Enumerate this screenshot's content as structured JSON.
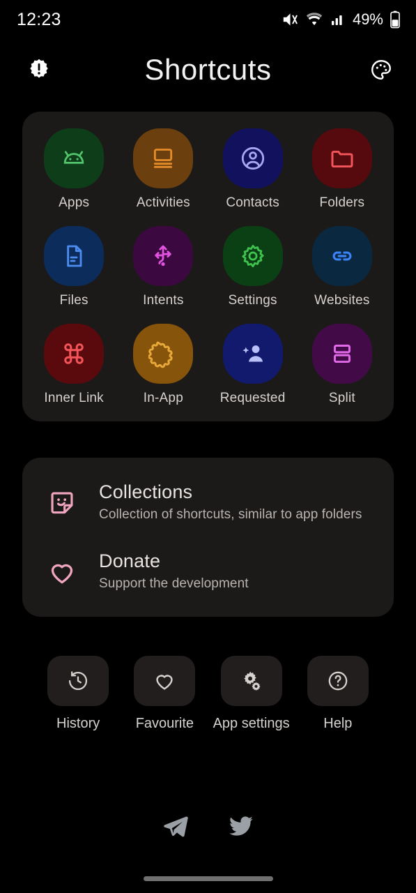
{
  "status_bar": {
    "time": "12:23",
    "battery_percent": "49%",
    "icons": [
      "mute-icon",
      "wifi-icon",
      "cellular-signal-icon",
      "battery-icon"
    ]
  },
  "app_bar": {
    "title": "Shortcuts",
    "left_icon": "new-releases-icon",
    "right_icon": "palette-icon"
  },
  "shortcut_grid": [
    {
      "label": "Apps",
      "icon": "android-icon",
      "bg": "#0d3d19",
      "fg": "#52c46b"
    },
    {
      "label": "Activities",
      "icon": "window-stack-icon",
      "bg": "#6b400e",
      "fg": "#e58b2a"
    },
    {
      "label": "Contacts",
      "icon": "account-circle-icon",
      "bg": "#12115e",
      "fg": "#a8a8f0"
    },
    {
      "label": "Folders",
      "icon": "folder-icon",
      "bg": "#560a0d",
      "fg": "#f4555a"
    },
    {
      "label": "Files",
      "icon": "document-icon",
      "bg": "#0c2c5c",
      "fg": "#4d8df0"
    },
    {
      "label": "Intents",
      "icon": "intent-arrows-icon",
      "bg": "#3c0840",
      "fg": "#e053de"
    },
    {
      "label": "Settings",
      "icon": "gear-icon",
      "bg": "#0b3f14",
      "fg": "#3fc34f"
    },
    {
      "label": "Websites",
      "icon": "link-icon",
      "bg": "#0a2940",
      "fg": "#3b82f6"
    },
    {
      "label": "Inner Link",
      "icon": "command-key-icon",
      "bg": "#5a0a0d",
      "fg": "#f4555a"
    },
    {
      "label": "In-App",
      "icon": "puzzle-piece-icon",
      "bg": "#86540b",
      "fg": "#e8a83a"
    },
    {
      "label": "Requested",
      "icon": "person-star-icon",
      "bg": "#121a6e",
      "fg": "#b8c2f8"
    },
    {
      "label": "Split",
      "icon": "split-screen-icon",
      "bg": "#420b48",
      "fg": "#e06ae8"
    }
  ],
  "list_items": [
    {
      "title": "Collections",
      "subtitle": "Collection of shortcuts, similar to app folders",
      "icon": "sticker-smile-icon",
      "color": "#f0a5c0"
    },
    {
      "title": "Donate",
      "subtitle": "Support the development",
      "icon": "heart-outline-icon",
      "color": "#f0a5c0"
    }
  ],
  "quick_actions": [
    {
      "label": "History",
      "icon": "history-clock-icon"
    },
    {
      "label": "Favourite",
      "icon": "heart-icon"
    },
    {
      "label": "App settings",
      "icon": "gears-settings-icon"
    },
    {
      "label": "Help",
      "icon": "help-circle-icon"
    }
  ],
  "footer_links": [
    {
      "name": "telegram-icon"
    },
    {
      "name": "twitter-icon"
    }
  ],
  "colors": {
    "page_background": "#000000",
    "card_background": "#1c1a19",
    "quick_button_background": "#211e1d",
    "primary_text": "#f2f2f2",
    "secondary_text": "#b9b4b1",
    "accent_pink": "#f0a5c0"
  }
}
